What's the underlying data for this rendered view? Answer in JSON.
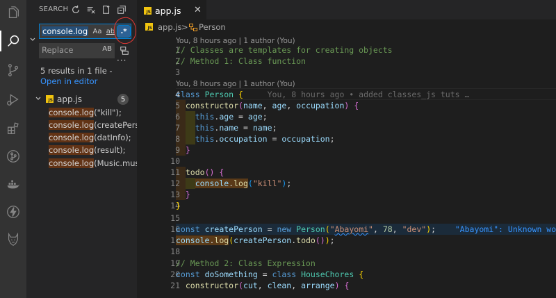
{
  "activity_bar": {
    "items": [
      {
        "icon": "explorer-icon"
      },
      {
        "icon": "search-icon"
      },
      {
        "icon": "source-control-icon"
      },
      {
        "icon": "run-debug-icon"
      },
      {
        "icon": "extensions-icon"
      },
      {
        "icon": "git-graph-icon"
      },
      {
        "icon": "docker-icon"
      },
      {
        "icon": "thunder-client-icon"
      },
      {
        "icon": "extension-wolf-icon"
      }
    ]
  },
  "search": {
    "title": "SEARCH",
    "query": "console.log",
    "match_case_label": "Aa",
    "whole_word_label": "ab",
    "regex_label": ".*",
    "replace_placeholder": "Replace",
    "preserve_case_label": "AB",
    "more_label": "···",
    "results_prefix": "5 results in 1 file - ",
    "results_link": "Open in editor",
    "file": {
      "name": "app.js",
      "badge": "JS",
      "count": "5"
    },
    "matches": [
      {
        "match": "console.log",
        "rest": "(\"kill\");"
      },
      {
        "match": "console.log",
        "rest": "(createPers..."
      },
      {
        "match": "console.log",
        "rest": "(datInfo);"
      },
      {
        "match": "console.log",
        "rest": "(result);"
      },
      {
        "match": "console.log",
        "rest": "(Music.musi..."
      }
    ]
  },
  "tab": {
    "label": "app.js",
    "badge": "JS",
    "close": "✕"
  },
  "breadcrumb": {
    "file": "app.js",
    "sep": ">",
    "symbol": "Person"
  },
  "editor": {
    "lens1": "You, 8 hours ago | 1 author (You)",
    "lens2": "You, 8 hours ago | 1 author (You)",
    "line_numbers": [
      "1",
      "2",
      "3",
      "4",
      "5",
      "6",
      "7",
      "8",
      "9",
      "10",
      "11",
      "12",
      "13",
      "14",
      "15",
      "16",
      "17",
      "18",
      "19",
      "20",
      "21"
    ],
    "blame": "You, 8 hours ago • added classes_js tuts …",
    "diagnostic": "\"Abayomi\": Unknown word.",
    "code": {
      "l1": "// Classes are templates for creating objects",
      "l2": "// Method 1: Class function",
      "l20": "// Method 2: Class Expression"
    }
  },
  "colors": {
    "accent": "#007fd4",
    "match_highlight": "#623315",
    "selection": "#264f78",
    "annotation_ring": "#e53935"
  }
}
